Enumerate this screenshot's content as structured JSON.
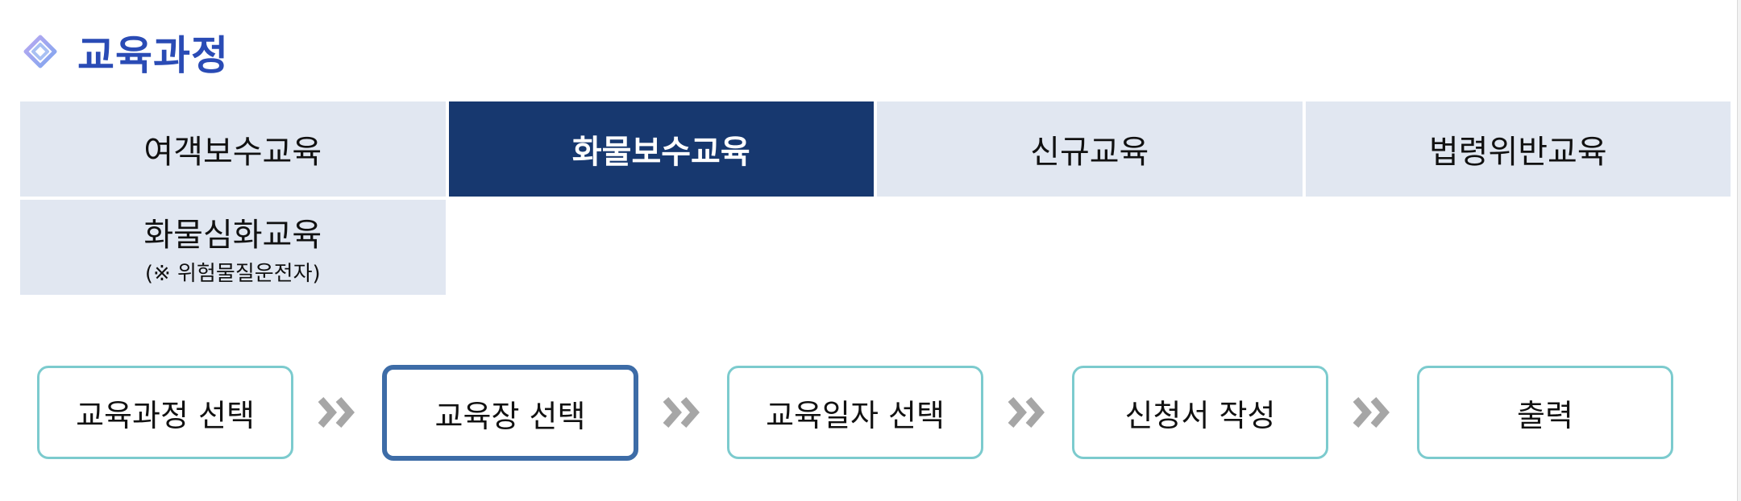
{
  "header": {
    "title": "교육과정",
    "icon": "diamond-layers-icon"
  },
  "tabs": [
    {
      "label": "여객보수교육",
      "sub": "",
      "active": false
    },
    {
      "label": "화물보수교육",
      "sub": "",
      "active": true
    },
    {
      "label": "신규교육",
      "sub": "",
      "active": false
    },
    {
      "label": "법령위반교육",
      "sub": "",
      "active": false
    },
    {
      "label": "화물심화교육",
      "sub": "(※ 위험물질운전자)",
      "active": false
    }
  ],
  "steps": [
    {
      "label": "교육과정 선택",
      "current": false
    },
    {
      "label": "교육장 선택",
      "current": true
    },
    {
      "label": "교육일자 선택",
      "current": false
    },
    {
      "label": "신청서 작성",
      "current": false
    },
    {
      "label": "출력",
      "current": false
    }
  ],
  "colors": {
    "title": "#2a4bb5",
    "tab_bg": "#e1e7f1",
    "tab_active_bg": "#17386f",
    "step_border": "#7ccbce",
    "step_current_border": "#3d6ca7",
    "arrow": "#a6a6a6"
  }
}
